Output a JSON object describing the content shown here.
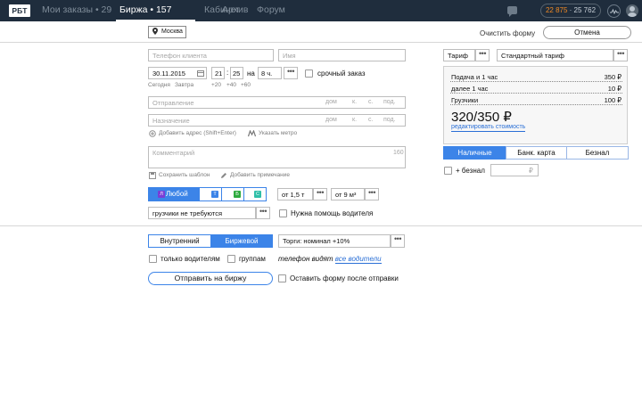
{
  "topbar": {
    "logo": "РБТ",
    "nav": [
      {
        "label": "Мои заказы • 29"
      },
      {
        "label": "Биржа • 157"
      },
      {
        "label": "Кабинет"
      },
      {
        "label": "Архив"
      },
      {
        "label": "Форум"
      }
    ],
    "balance_primary": "22 875",
    "balance_separator": " · ",
    "balance_secondary": "25 762",
    "colors": {
      "bar": "#1f2d3d",
      "balance": "#f08a24"
    }
  },
  "form_header": {
    "city": "Москва",
    "clear_label": "Очистить форму",
    "cancel_label": "Отмена"
  },
  "client": {
    "phone_placeholder": "Телефон клиента",
    "name_placeholder": "Имя"
  },
  "datetime": {
    "date": "30.11.2015",
    "hour": "21",
    "colon": ":",
    "minute": "25",
    "on_label": "на",
    "duration": "8 ч.",
    "urgent_label": "срочный заказ",
    "today": "Сегодня",
    "tomorrow": "Завтра",
    "plus20": "+20",
    "plus40": "+40",
    "plus60": "+60"
  },
  "route": {
    "from_placeholder": "Отправление",
    "to_placeholder": "Назначение",
    "house": "дом",
    "building": "к.",
    "structure": "с.",
    "entrance": "под.",
    "add_address": "Добавить адрес (Shift+Enter)",
    "metro": "Указать метро"
  },
  "comment": {
    "placeholder": "Комментарий",
    "counter": "160",
    "save_template": "Сохранить шаблон",
    "add_note": "Добавить примечание"
  },
  "vehicle": {
    "any_letter": "Л",
    "any_label": "Любой",
    "badges": [
      {
        "letter": "Т",
        "color": "#3c84e8"
      },
      {
        "letter": "Б",
        "color": "#2eaa3e"
      },
      {
        "letter": "С",
        "color": "#2fbfa8"
      }
    ],
    "weight": "от 1,5 т",
    "volume": "от 9 м³",
    "loaders": "грузчики не требуются",
    "driver_help": "Нужна помощь водителя"
  },
  "exchange": {
    "internal": "Внутренний",
    "exchange": "Биржевой",
    "bidding": "Торги: номинал +10%",
    "only_drivers": "только водителям",
    "groups": "группам",
    "phone_visible": "телефон видят",
    "all_drivers": "все водители",
    "submit": "Отправить на биржу",
    "keep_form": "Оставить форму после отправки"
  },
  "tariff": {
    "label": "Тариф",
    "value": "Стандартный тариф",
    "rows": [
      {
        "name": "Подача и 1 час",
        "price": "350 ₽"
      },
      {
        "name": "далее 1 час",
        "price": "10 ₽"
      },
      {
        "name": "Грузчики",
        "price": "100 ₽"
      }
    ],
    "total": "320/350 ₽",
    "edit_link": "редактировать стоимость"
  },
  "payment": {
    "options": [
      "Наличные",
      "Банк. карта",
      "Безнал"
    ],
    "cashless_label": "+ безнал",
    "amount_placeholder": "₽"
  }
}
